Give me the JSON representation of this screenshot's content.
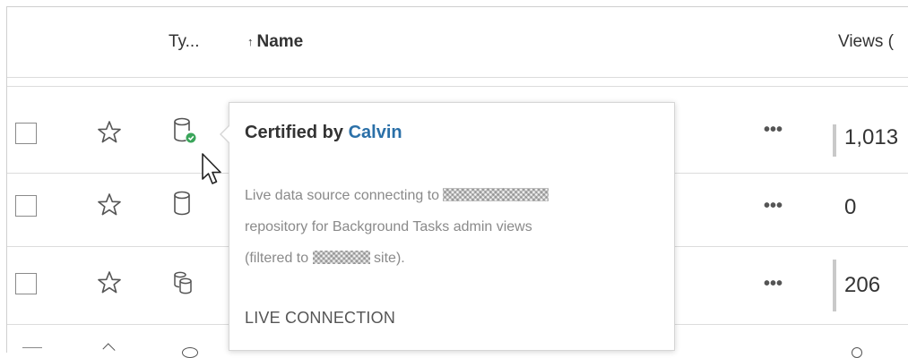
{
  "header": {
    "type_label": "Ty...",
    "sort_arrow": "↑",
    "name_label": "Name",
    "views_label": "Views ("
  },
  "rows": [
    {
      "views": "1,013",
      "more_label": "•••",
      "certified": true,
      "icon": "database-certified-icon"
    },
    {
      "views": "0",
      "more_label": "•••",
      "certified": false,
      "icon": "database-icon"
    },
    {
      "views": "206",
      "more_label": "•••",
      "certified": false,
      "icon": "database-multi-icon"
    }
  ],
  "tooltip": {
    "title_prefix": "Certified by",
    "certifier": "Calvin",
    "desc_line1": "Live data source connecting to",
    "desc_line2": "repository for Background Tasks admin views",
    "desc_line3_a": "(filtered to",
    "desc_line3_b": "site).",
    "connection": "LIVE CONNECTION"
  },
  "colors": {
    "certified_badge": "#3aa55a",
    "link": "#2b70a8",
    "border": "#cfcfcf"
  }
}
